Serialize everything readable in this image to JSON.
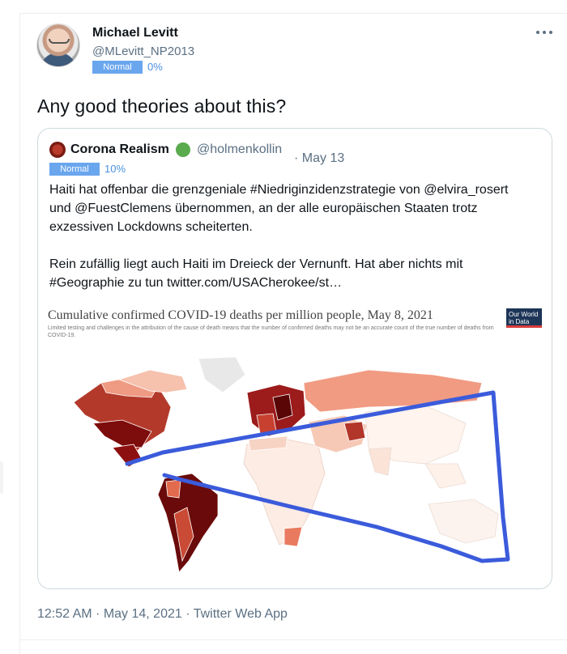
{
  "tweet": {
    "author": {
      "name": "Michael Levitt",
      "handle": "@MLevitt_NP2013",
      "badge": "Normal",
      "percent": "0%"
    },
    "text": "Any good theories about this?",
    "timestamp": "12:52 AM · May 14, 2021 · Twitter Web App"
  },
  "quote": {
    "author": {
      "name": "Corona Realism",
      "handle": "@holmenkollin",
      "date": "· May 13",
      "badge": "Normal",
      "percent": "10%"
    },
    "lines": [
      "Haiti hat offenbar die grenzgeniale #Niedriginzidenzstrategie von @elvira_rosert",
      "und @FuestClemens übernommen, an der alle europäischen Staaten trotz",
      "exzessiven Lockdowns scheiterten.",
      "Rein zufällig liegt auch Haiti im Dreieck der Vernunft. Hat aber nichts mit",
      "#Geographie zu tun  twitter.com/USACherokee/st…"
    ],
    "map": {
      "title": "Cumulative confirmed COVID-19 deaths per million people, May 8, 2021",
      "subtitle": "Limited testing and challenges in the attribution of the cause of death means that the number of confirmed deaths may not be an accurate count of the true number of deaths from COVID-19.",
      "logo_line1": "Our World",
      "logo_line2": "in Data"
    }
  },
  "colors": {
    "accent": "#1da1f2",
    "muted": "#5b7083",
    "badge": "#6aa6ee",
    "triangle": "#3b5bdb"
  },
  "icons": {
    "more": "more-horizontal-icon",
    "verified": "green-circle-emoji-icon"
  }
}
